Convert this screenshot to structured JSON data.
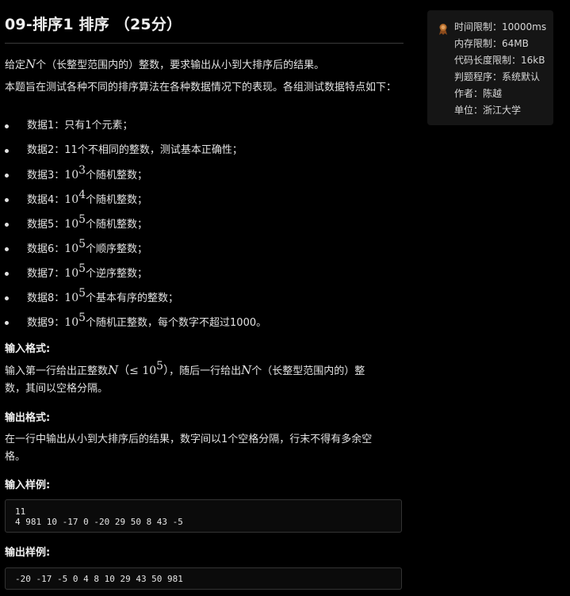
{
  "problem": {
    "title": "09-排序1 排序 （25分）",
    "intro": {
      "before": "给定",
      "var": "N",
      "after": "个（长整型范围内的）整数，要求输出从小到大排序后的结果。"
    },
    "description": "本题旨在测试各种不同的排序算法在各种数据情况下的表现。各组测试数据特点如下：",
    "cases": [
      {
        "prefix": "数据1：只有1个元素；",
        "base": "",
        "exp": "",
        "suffix": ""
      },
      {
        "prefix": "数据2：11个不相同的整数，测试基本正确性；",
        "base": "",
        "exp": "",
        "suffix": ""
      },
      {
        "prefix": "数据3：",
        "base": "10",
        "exp": "3",
        "suffix": "个随机整数；"
      },
      {
        "prefix": "数据4：",
        "base": "10",
        "exp": "4",
        "suffix": "个随机整数；"
      },
      {
        "prefix": "数据5：",
        "base": "10",
        "exp": "5",
        "suffix": "个随机整数；"
      },
      {
        "prefix": "数据6：",
        "base": "10",
        "exp": "5",
        "suffix": "个顺序整数；"
      },
      {
        "prefix": "数据7：",
        "base": "10",
        "exp": "5",
        "suffix": "个逆序整数；"
      },
      {
        "prefix": "数据8：",
        "base": "10",
        "exp": "5",
        "suffix": "个基本有序的整数；"
      },
      {
        "prefix": "数据9：",
        "base": "10",
        "exp": "5",
        "suffix": "个随机正整数，每个数字不超过1000。"
      }
    ],
    "input_format": {
      "heading": "输入格式:",
      "t1": "输入第一行给出正整数",
      "var1": "N",
      "cond": "（≤ 10",
      "cond_exp": "5",
      "cond_end": "）",
      "t2": "，随后一行给出",
      "var2": "N",
      "t3": "个（长整型范围内的）整",
      "line2": "数，其间以空格分隔。"
    },
    "output_format": {
      "heading": "输出格式:",
      "line1": "在一行中输出从小到大排序后的结果，数字间以1个空格分隔，行末不得有多余空",
      "line2": "格。"
    },
    "sample_input": {
      "heading": "输入样例:",
      "lines": [
        "11",
        "4 981 10 -17 0 -20 29 50 8 43 -5"
      ]
    },
    "sample_output": {
      "heading": "输出样例:",
      "lines": [
        "-20 -17 -5 0 4 8 10 29 43 50 981"
      ]
    }
  },
  "limits": {
    "icon": "award-ribbon-icon",
    "time": "时间限制：10000ms",
    "memory": "内存限制：64MB",
    "code_length": "代码长度限制：16kB",
    "judge": "判题程序：系统默认",
    "author": "作者：陈越",
    "unit": "单位：浙江大学"
  },
  "colors": {
    "background": "#000000",
    "panel": "#151515",
    "icon_accent": "#b36b2a"
  }
}
